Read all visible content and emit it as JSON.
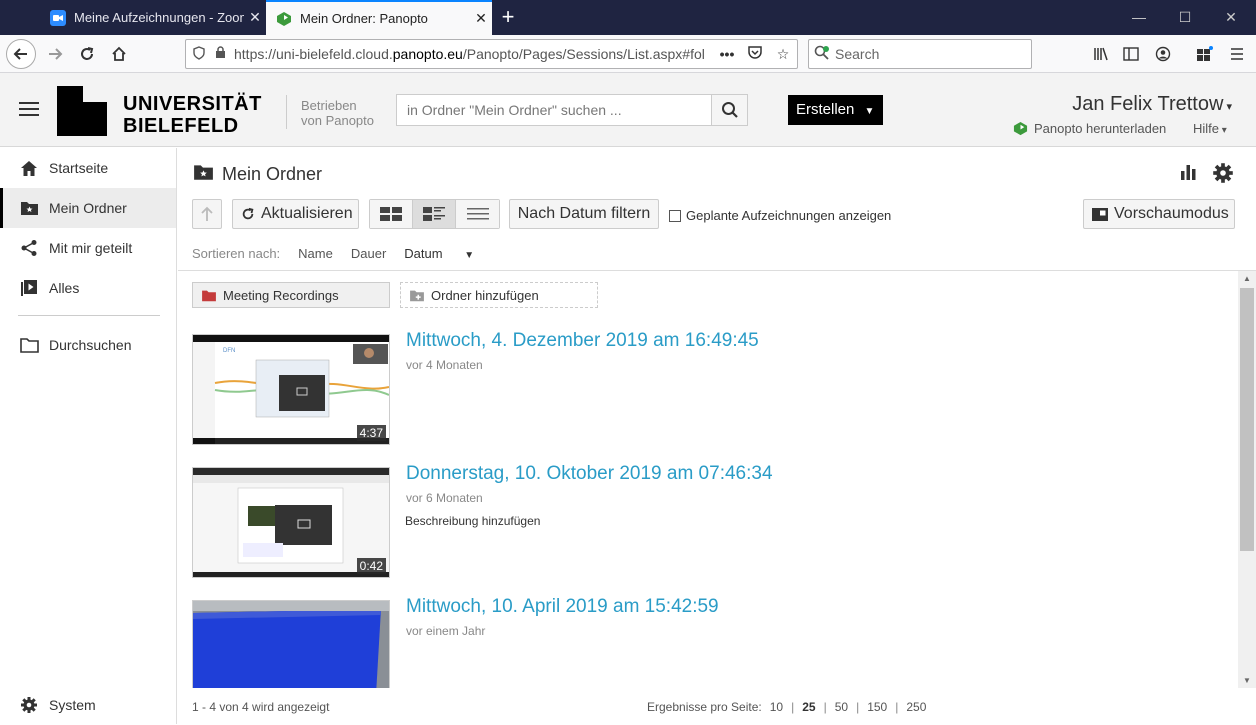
{
  "browser": {
    "tabs": [
      {
        "title": "Meine Aufzeichnungen - Zoom",
        "active": false
      },
      {
        "title": "Mein Ordner: Panopto",
        "active": true
      }
    ],
    "url_prefix": "https://uni-bielefeld.cloud.",
    "url_domain": "panopto.eu",
    "url_suffix": "/Panopto/Pages/Sessions/List.aspx#fol",
    "search_placeholder": "Search"
  },
  "header": {
    "logo_line1": "UNIVERSITÄT",
    "logo_line2": "BIELEFELD",
    "powered_line1": "Betrieben",
    "powered_line2": "von Panopto",
    "search_placeholder": "in Ordner \"Mein Ordner\" suchen ...",
    "create_label": "Erstellen",
    "user_name": "Jan Felix Trettow",
    "download_label": "Panopto herunterladen",
    "help_label": "Hilfe"
  },
  "sidebar": {
    "items": [
      {
        "label": "Startseite",
        "icon": "home-icon"
      },
      {
        "label": "Mein Ordner",
        "icon": "folder-star-icon",
        "selected": true
      },
      {
        "label": "Mit mir geteilt",
        "icon": "share-icon"
      },
      {
        "label": "Alles",
        "icon": "video-library-icon"
      },
      {
        "label": "Durchsuchen",
        "icon": "folder-icon"
      }
    ],
    "system_label": "System"
  },
  "main": {
    "folder_title": "Mein Ordner",
    "refresh_label": "Aktualisieren",
    "date_filter_label": "Nach Datum filtern",
    "scheduled_label": "Geplante Aufzeichnungen anzeigen",
    "preview_label": "Vorschaumodus",
    "sort": {
      "prefix": "Sortieren nach:",
      "name": "Name",
      "duration": "Dauer",
      "date": "Datum"
    },
    "subfolder_label": "Meeting Recordings",
    "add_folder_label": "Ordner hinzufügen",
    "sessions": [
      {
        "title": "Mittwoch, 4. Dezember 2019 am 16:49:45",
        "age": "vor 4 Monaten",
        "duration": "4:37",
        "description": ""
      },
      {
        "title": "Donnerstag, 10. Oktober 2019 am 07:46:34",
        "age": "vor 6 Monaten",
        "duration": "0:42",
        "description": "Beschreibung hinzufügen"
      },
      {
        "title": "Mittwoch, 10. April 2019 am 15:42:59",
        "age": "vor einem Jahr",
        "duration": "",
        "description": ""
      }
    ],
    "footer": {
      "count_text": "1 - 4 von 4 wird angezeigt",
      "per_page_label": "Ergebnisse pro Seite:",
      "per_page_options": [
        "10",
        "25",
        "50",
        "150",
        "250"
      ],
      "per_page_selected": "25"
    }
  },
  "colors": {
    "accent_link": "#2a9cc7",
    "tabbar_bg": "#1f2441",
    "create_bg": "#000000"
  }
}
